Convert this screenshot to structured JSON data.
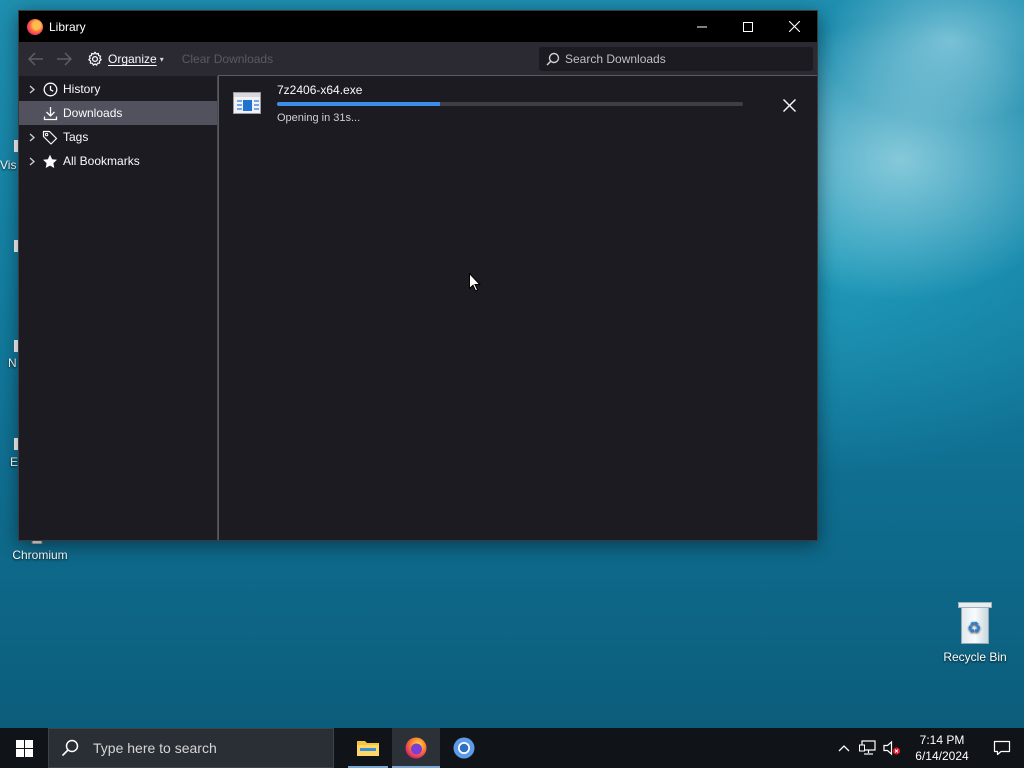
{
  "desktop": {
    "recycle_bin_label": "Recycle Bin",
    "chromium_label": "Chromium",
    "frag_vis": "Vis",
    "frag_n": "N",
    "frag_e": "E"
  },
  "window": {
    "title": "Library",
    "toolbar": {
      "organize_label": "Organize",
      "clear_downloads_label": "Clear Downloads",
      "search_placeholder": "Search Downloads"
    },
    "sidebar": {
      "items": [
        {
          "label": "History",
          "icon": "clock-icon",
          "has_twisty": true
        },
        {
          "label": "Downloads",
          "icon": "download-icon",
          "has_twisty": false,
          "selected": true
        },
        {
          "label": "Tags",
          "icon": "tag-icon",
          "has_twisty": true
        },
        {
          "label": "All Bookmarks",
          "icon": "star-icon",
          "has_twisty": true
        }
      ]
    },
    "downloads": [
      {
        "filename": "7z2406-x64.exe",
        "status": "Opening in 31s...",
        "progress_percent": 35
      }
    ]
  },
  "taskbar": {
    "search_placeholder": "Type here to search",
    "time": "7:14 PM",
    "date": "6/14/2024"
  },
  "colors": {
    "accent": "#3d8de8",
    "selected_row": "#52525e",
    "window_bg": "#1c1b22",
    "toolbar_bg": "#2b2a33"
  }
}
